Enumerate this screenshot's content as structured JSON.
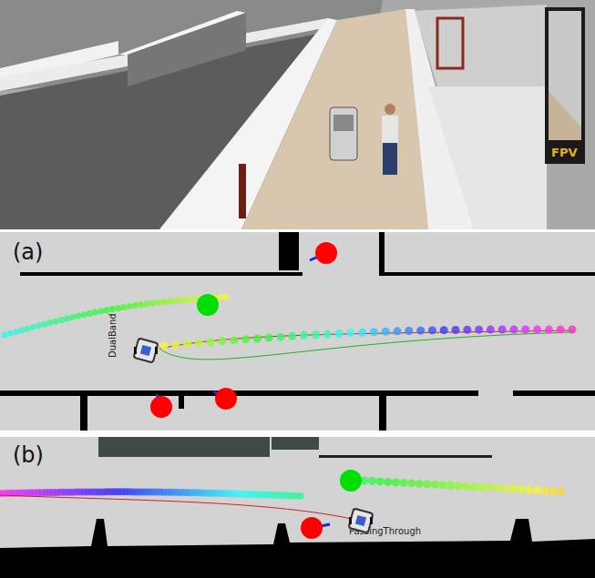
{
  "scene": {
    "inset_label": "FPV"
  },
  "panels": [
    {
      "label": "(a)",
      "robot_label": "DualBand",
      "people": [
        {
          "color": "#ff0000"
        },
        {
          "color": "#00e000"
        },
        {
          "color": "#ff0000"
        },
        {
          "color": "#ff0000"
        }
      ]
    },
    {
      "label": "(b)",
      "robot_label": "PassingThrough",
      "people": [
        {
          "color": "#00e000"
        },
        {
          "color": "#ff0000"
        }
      ]
    }
  ]
}
